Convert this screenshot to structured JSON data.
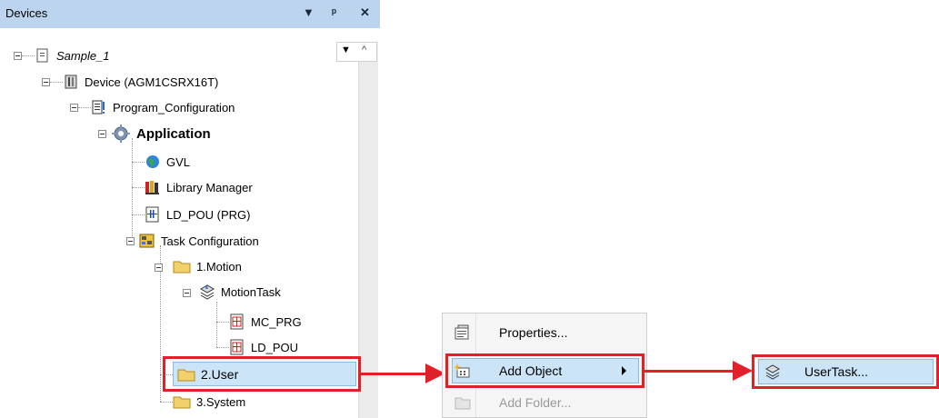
{
  "panel": {
    "title": "Devices",
    "buttons": [
      "▾",
      "ᵖ",
      "✕"
    ]
  },
  "tree": {
    "items": [
      {
        "label": "Sample_1",
        "italic": true
      },
      {
        "label": "Device (AGM1CSRX16T)"
      },
      {
        "label": "Program_Configuration"
      },
      {
        "label": "Application",
        "bold": true
      },
      {
        "label": "GVL"
      },
      {
        "label": "Library Manager"
      },
      {
        "label": "LD_POU (PRG)"
      },
      {
        "label": "Task Configuration"
      },
      {
        "label": "1.Motion"
      },
      {
        "label": "MotionTask"
      },
      {
        "label": "MC_PRG"
      },
      {
        "label": "LD_POU"
      },
      {
        "label": "2.User",
        "selected": true
      },
      {
        "label": "3.System"
      }
    ]
  },
  "context_menu": {
    "items": [
      {
        "label": "Properties...",
        "icon": "properties-icon",
        "enabled": true
      },
      {
        "label": "Add Object",
        "icon": "add-object-icon",
        "enabled": true,
        "highlighted": true,
        "submenu": true
      },
      {
        "label": "Add Folder...",
        "icon": "folder-icon",
        "enabled": false
      }
    ]
  },
  "submenu": {
    "items": [
      {
        "label": "UserTask...",
        "icon": "task-icon",
        "highlighted": true
      }
    ]
  },
  "colors": {
    "header_bg": "#bcd4ee",
    "selection_bg": "#cce4f7",
    "highlight_red": "#e2202a"
  }
}
